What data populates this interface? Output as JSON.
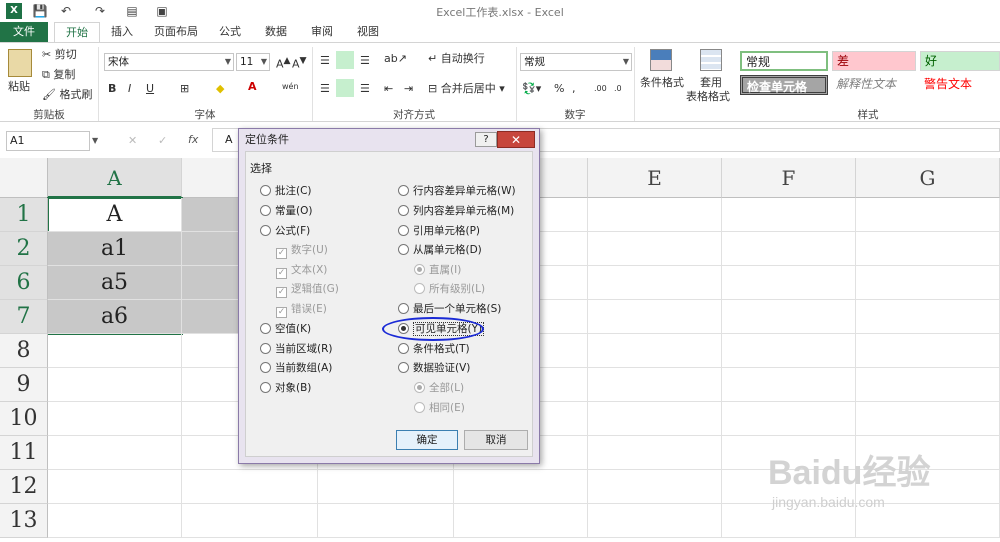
{
  "window": {
    "title": "Excel工作表.xlsx - Excel"
  },
  "tabs": {
    "file": "文件",
    "items": [
      "开始",
      "插入",
      "页面布局",
      "公式",
      "数据",
      "审阅",
      "视图"
    ]
  },
  "clipboard": {
    "paste": "粘贴",
    "cut": "剪切",
    "copy": "复制",
    "format_painter": "格式刷",
    "label": "剪贴板"
  },
  "font": {
    "name": "宋体",
    "size": "11",
    "label": "字体",
    "bold": "B",
    "italic": "I",
    "underline": "U",
    "wen": "wén"
  },
  "alignment": {
    "wrap": "自动换行",
    "merge": "合并后居中",
    "label": "对齐方式"
  },
  "number": {
    "format": "常规",
    "label": "数字",
    "percent": "%"
  },
  "styles": {
    "cond_format": "条件格式",
    "table_format_1": "套用",
    "table_format_2": "表格格式",
    "normal": "常规",
    "bad": "差",
    "good": "好",
    "check_cell": "检查单元格",
    "explanatory": "解释性文本",
    "warning": "警告文本",
    "label": "样式"
  },
  "formula_bar": {
    "name_box": "A1",
    "fx": "fx",
    "content": "A"
  },
  "grid": {
    "columns": [
      "A",
      "E",
      "F",
      "G"
    ],
    "rows": [
      {
        "num": "1",
        "value": "A"
      },
      {
        "num": "2",
        "value": "a1"
      },
      {
        "num": "6",
        "value": "a5"
      },
      {
        "num": "7",
        "value": "a6"
      },
      {
        "num": "8",
        "value": ""
      },
      {
        "num": "9",
        "value": ""
      },
      {
        "num": "10",
        "value": ""
      },
      {
        "num": "11",
        "value": ""
      },
      {
        "num": "12",
        "value": ""
      },
      {
        "num": "13",
        "value": ""
      }
    ]
  },
  "dialog": {
    "title": "定位条件",
    "section": "选择",
    "left": [
      "批注(C)",
      "常量(O)",
      "公式(F)",
      "数字(U)",
      "文本(X)",
      "逻辑值(G)",
      "错误(E)",
      "空值(K)",
      "当前区域(R)",
      "当前数组(A)",
      "对象(B)"
    ],
    "right": [
      "行内容差异单元格(W)",
      "列内容差异单元格(M)",
      "引用单元格(P)",
      "从属单元格(D)",
      "直属(I)",
      "所有级别(L)",
      "最后一个单元格(S)",
      "可见单元格(Y)",
      "条件格式(T)",
      "数据验证(V)",
      "全部(L)",
      "相同(E)"
    ],
    "selected": "可见单元格(Y)",
    "ok": "确定",
    "cancel": "取消",
    "help": "?",
    "close": "✕"
  },
  "watermark": {
    "brand": "Baidu经验",
    "url": "jingyan.baidu.com"
  }
}
